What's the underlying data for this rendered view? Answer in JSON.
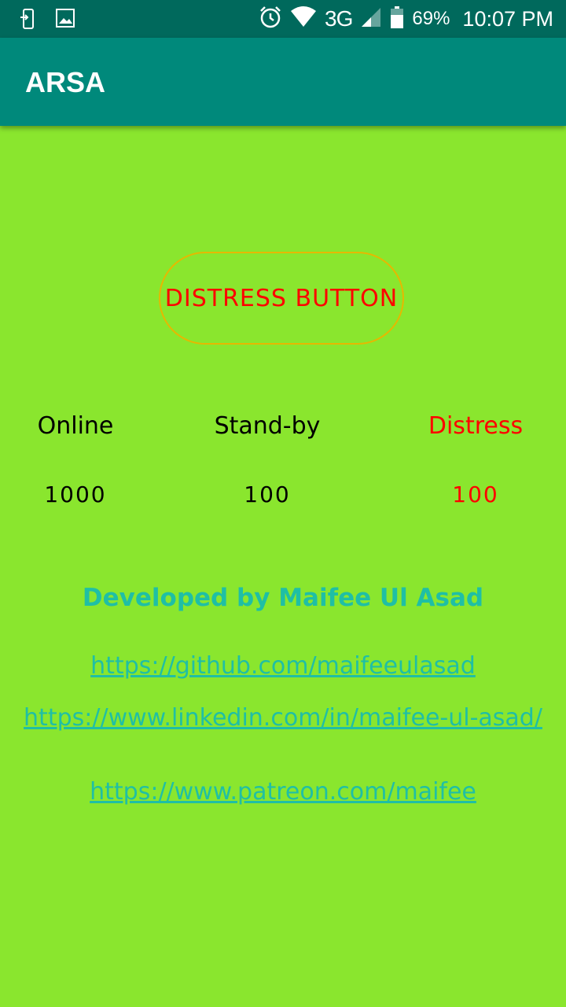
{
  "status_bar": {
    "battery": "69%",
    "network": "3G",
    "time": "10:07 PM",
    "icons": [
      "sim-icon",
      "image-icon",
      "alarm-icon",
      "wifi-icon",
      "signal-icon",
      "battery-icon"
    ]
  },
  "app_bar": {
    "title": "ARSA"
  },
  "main": {
    "distress_button_label": "DISTRESS BUTTON",
    "stats": {
      "online_label": "Online",
      "online_value": "1000",
      "standby_label": "Stand-by",
      "standby_value": "100",
      "distress_label": "Distress",
      "distress_value": "100"
    },
    "developer": {
      "credit": "Developed by Maifee Ul Asad",
      "github": "https://github.com/maifeeulasad",
      "linkedin": "https://www.linkedin.com/in/maifee-ul-asad/",
      "patreon": "https://www.patreon.com/maifee"
    }
  },
  "colors": {
    "background": "#8ae62e",
    "app_bar": "#00897b",
    "status_bar": "#00695c",
    "distress": "#ff0000",
    "link": "#1fbfa5",
    "button_border": "#e6b800"
  }
}
